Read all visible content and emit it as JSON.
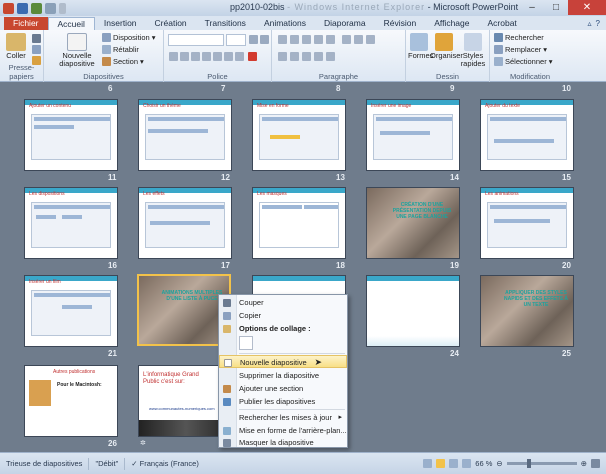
{
  "titlebar": {
    "doc_name": "pp2010-02bis",
    "blurred": "- Windows Internet Explorer",
    "app": "- Microsoft PowerPoint"
  },
  "tabs": [
    "Fichier",
    "Accueil",
    "Insertion",
    "Création",
    "Transitions",
    "Animations",
    "Diaporama",
    "Révision",
    "Affichage",
    "Acrobat"
  ],
  "active_tab": "Accueil",
  "ribbon": {
    "clipboard": {
      "label": "Presse-papiers",
      "paste": "Coller"
    },
    "slides": {
      "label": "Diapositives",
      "new_slide": "Nouvelle diapositive",
      "layout": "Disposition",
      "reset": "Rétablir",
      "section": "Section"
    },
    "font": {
      "label": "Police"
    },
    "paragraph": {
      "label": "Paragraphe"
    },
    "drawing": {
      "label": "Dessin",
      "shapes": "Formes",
      "arrange": "Organiser",
      "styles": "Styles rapides"
    },
    "editing": {
      "label": "Modification",
      "find": "Rechercher",
      "replace": "Remplacer",
      "select": "Sélectionner"
    }
  },
  "numbers": {
    "r0": [
      "6",
      "7",
      "8",
      "9",
      "10"
    ],
    "r1": [
      "11",
      "12",
      "13",
      "14",
      "15"
    ],
    "r2": [
      "16",
      "17",
      "18",
      "19",
      "20"
    ],
    "r3": [
      "21",
      "24",
      "25"
    ],
    "r4": [
      "26"
    ]
  },
  "slides": {
    "s19_text": "CRÉATION D'UNE PRÉSENTATION DEPUIS UNE PAGE BLANCHE",
    "s22_text": "ANIMATIONS MULTIPLES D'UNE LISTE À PUCE",
    "s25_text": "APPLIQUER DES STYLES NAPIDS ET DES EFFETS À UN TEXTE",
    "s26_title": "Autres publications",
    "s26_body": "Pour le Macintosh:",
    "s27_title": "L'informatique Grand Public c'est sur:",
    "s27_url": "www.communautes-numeriques.com"
  },
  "menu": {
    "cut": "Couper",
    "copy": "Copier",
    "paste_options": "Options de collage :",
    "new_slide": "Nouvelle diapositive",
    "delete_slide": "Supprimer la diapositive",
    "add_section": "Ajouter une section",
    "publish": "Publier les diapositives",
    "check_updates": "Rechercher les mises à jour",
    "format_bg": "Mise en forme de l'arrière-plan...",
    "hide": "Masquer la diapositive"
  },
  "status": {
    "view": "Trieuse de diapositives",
    "theme": "\"Débit\"",
    "lang": "Français (France)",
    "zoom": "66 %",
    "zoom_fraction": 0.66
  },
  "colors": {
    "file_tab": "#c8472f",
    "accent": "#3aa7c9",
    "selection": "#f2c24a",
    "close": "#c8423a"
  }
}
